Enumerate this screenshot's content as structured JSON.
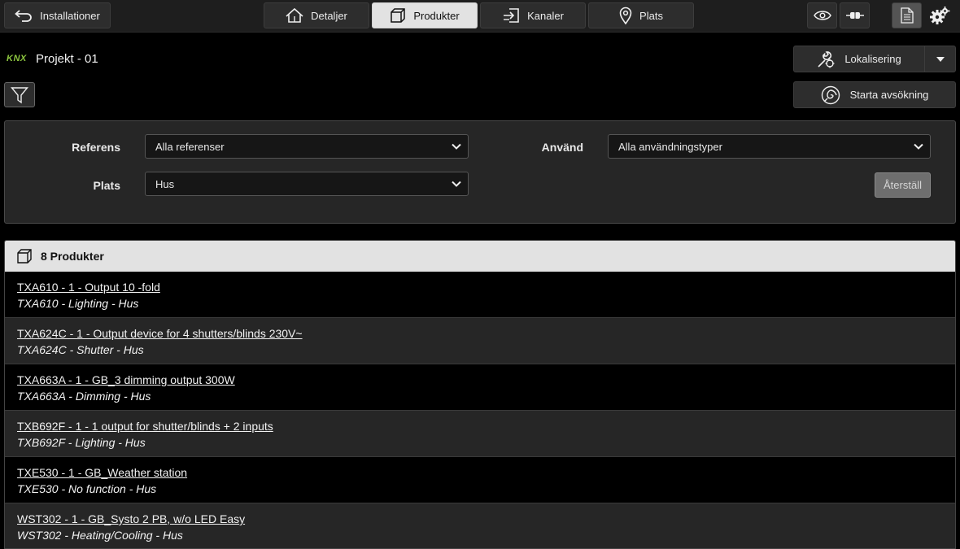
{
  "topbar": {
    "back_label": "Installationer",
    "tabs": [
      {
        "label": "Detaljer",
        "icon": "house-icon"
      },
      {
        "label": "Produkter",
        "icon": "box-icon",
        "active": true
      },
      {
        "label": "Kanaler",
        "icon": "channel-enter-icon"
      },
      {
        "label": "Plats",
        "icon": "location-pin-icon"
      }
    ],
    "right_icons": [
      "eye-icon",
      "cable-plug-icon",
      "document-icon",
      "gears-icon"
    ]
  },
  "project": {
    "logo_text": "KNX",
    "name": "Projekt - 01"
  },
  "actions": {
    "localize_label": "Lokalisering",
    "scan_label": "Starta avsökning"
  },
  "filters": {
    "reference_label": "Referens",
    "reference_value": "Alla referenser",
    "use_label": "Använd",
    "use_value": "Alla användningstyper",
    "location_label": "Plats",
    "location_value": "Hus",
    "reset_label": "Återställ"
  },
  "products": {
    "header": "8 Produkter",
    "items": [
      {
        "title": "TXA610 - 1 - Output 10 -fold",
        "sub": "TXA610 - Lighting - Hus"
      },
      {
        "title": "TXA624C - 1 - Output device for 4 shutters/blinds 230V~",
        "sub": "TXA624C - Shutter - Hus"
      },
      {
        "title": "TXA663A - 1 - GB_3 dimming output 300W",
        "sub": "TXA663A - Dimming - Hus"
      },
      {
        "title": "TXB692F - 1 - 1 output for shutter/blinds + 2 inputs",
        "sub": "TXB692F - Lighting - Hus"
      },
      {
        "title": "TXE530 - 1 - GB_Weather station",
        "sub": "TXE530 - No function - Hus"
      },
      {
        "title": "WST302 - 1 - GB_Systo 2 PB, w/o LED Easy",
        "sub": "WST302 - Heating/Cooling - Hus"
      }
    ]
  },
  "colors": {
    "background": "#000000",
    "panel": "#262626",
    "active_tab": "#e2e2e2",
    "knx_green": "#8dc63f"
  }
}
